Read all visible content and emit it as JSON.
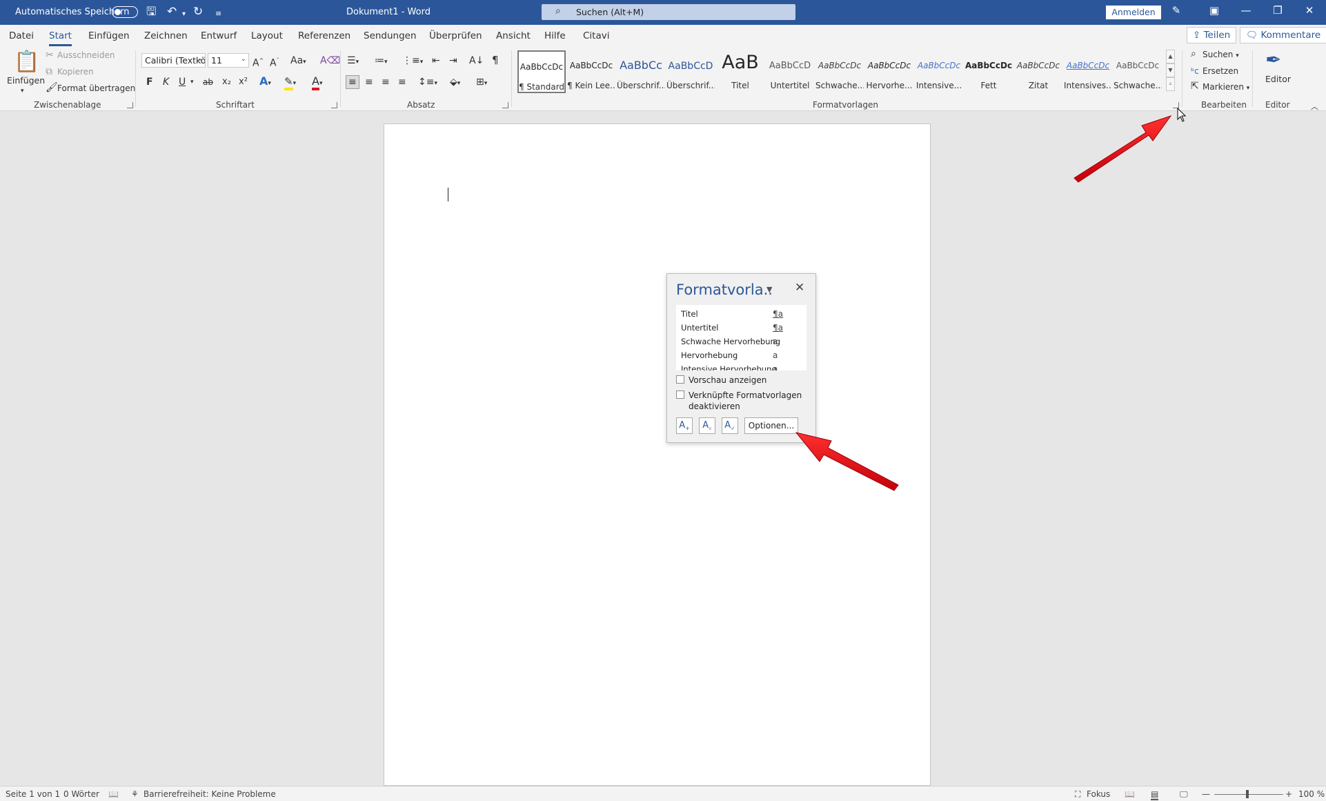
{
  "titlebar": {
    "autosave_label": "Automatisches Speichern",
    "doc_title": "Dokument1  -  Word",
    "search_placeholder": "Suchen (Alt+M)",
    "signin_label": "Anmelden"
  },
  "menu": {
    "tabs": [
      "Datei",
      "Start",
      "Einfügen",
      "Zeichnen",
      "Entwurf",
      "Layout",
      "Referenzen",
      "Sendungen",
      "Überprüfen",
      "Ansicht",
      "Hilfe",
      "Citavi"
    ],
    "active_tab": "Start",
    "share_label": "Teilen",
    "comments_label": "Kommentare"
  },
  "ribbon": {
    "clipboard": {
      "group_label": "Zwischenablage",
      "paste_label": "Einfügen",
      "cut_label": "Ausschneiden",
      "copy_label": "Kopieren",
      "format_painter_label": "Format übertragen"
    },
    "font": {
      "group_label": "Schriftart",
      "font_name": "Calibri (Textkö",
      "font_size": "11",
      "case_label": "Aa",
      "bold_label": "F",
      "italic_label": "K",
      "underline_label": "U",
      "strike_label": "ab",
      "sub_label": "x₂",
      "super_label": "x²"
    },
    "paragraph": {
      "group_label": "Absatz"
    },
    "styles": {
      "group_label": "Formatvorlagen",
      "items": [
        {
          "preview": "AaBbCcDc",
          "name": "¶ Standard"
        },
        {
          "preview": "AaBbCcDc",
          "name": "¶ Kein Lee..."
        },
        {
          "preview": "AaBbCc",
          "name": "Überschrif..."
        },
        {
          "preview": "AaBbCcD",
          "name": "Überschrif..."
        },
        {
          "preview": "AaB",
          "name": "Titel"
        },
        {
          "preview": "AaBbCcD",
          "name": "Untertitel"
        },
        {
          "preview": "AaBbCcDc",
          "name": "Schwache..."
        },
        {
          "preview": "AaBbCcDc",
          "name": "Hervorhe..."
        },
        {
          "preview": "AaBbCcDc",
          "name": "Intensive..."
        },
        {
          "preview": "AaBbCcDc",
          "name": "Fett"
        },
        {
          "preview": "AaBbCcDc",
          "name": "Zitat"
        },
        {
          "preview": "AaBbCcDc",
          "name": "Intensives..."
        },
        {
          "preview": "AaBbCcDc",
          "name": "Schwache..."
        }
      ]
    },
    "editing": {
      "group_label": "Bearbeiten",
      "find_label": "Suchen",
      "replace_label": "Ersetzen",
      "select_label": "Markieren"
    },
    "editor": {
      "group_label": "Editor",
      "editor_label": "Editor"
    }
  },
  "styles_pane": {
    "title": "Formatvorla..",
    "list": [
      {
        "name": "Titel",
        "symbol": "¶a"
      },
      {
        "name": "Untertitel",
        "symbol": "¶a"
      },
      {
        "name": "Schwache Hervorhebung",
        "symbol": "a"
      },
      {
        "name": "Hervorhebung",
        "symbol": "a"
      },
      {
        "name": "Intensive Hervorhebung",
        "symbol": "a"
      }
    ],
    "preview_checkbox": "Vorschau anzeigen",
    "linked_checkbox_line1": "Verknüpfte Formatvorlagen",
    "linked_checkbox_line2": "deaktivieren",
    "options_label": "Optionen..."
  },
  "statusbar": {
    "page": "Seite 1 von 1",
    "words": "0 Wörter",
    "accessibility": "Barrierefreiheit: Keine Probleme",
    "focus": "Fokus",
    "zoom": "100 %"
  },
  "colors": {
    "accent": "#2b579a",
    "annotation_arrow": "#e8141e"
  }
}
